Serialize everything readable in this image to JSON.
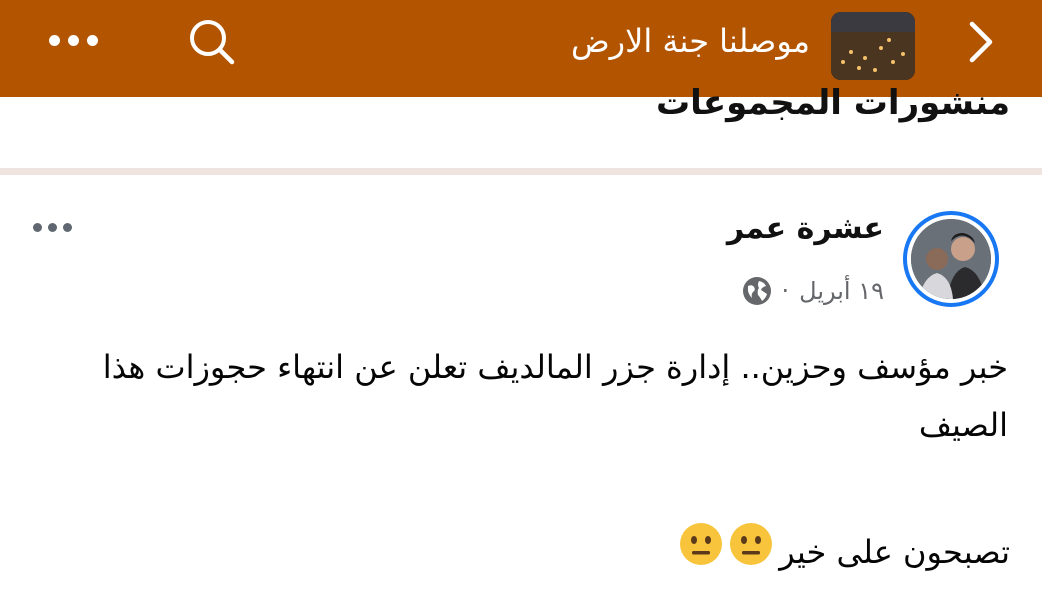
{
  "header": {
    "group_name": "موصلنا جنة الارض",
    "more_icon": "more-dots-icon",
    "search_icon": "search-icon",
    "forward_icon": "chevron-right-icon",
    "bg_color": "#b35400"
  },
  "section": {
    "title": "منشورات المجموعات"
  },
  "post": {
    "author": "عشرة عمر",
    "date": "١٩ أبريل",
    "separator": "·",
    "privacy_icon": "globe-icon",
    "more_icon": "more-dots-icon",
    "text": "خبر مؤسف وحزين.. إدارة جزر المالديف تعلن عن انتهاء حجوزات هذا الصيف",
    "line2": "تصبحون على خير",
    "emojis": [
      "neutral-face-emoji",
      "neutral-face-emoji"
    ],
    "avatar_ring_color": "#1877f2"
  }
}
